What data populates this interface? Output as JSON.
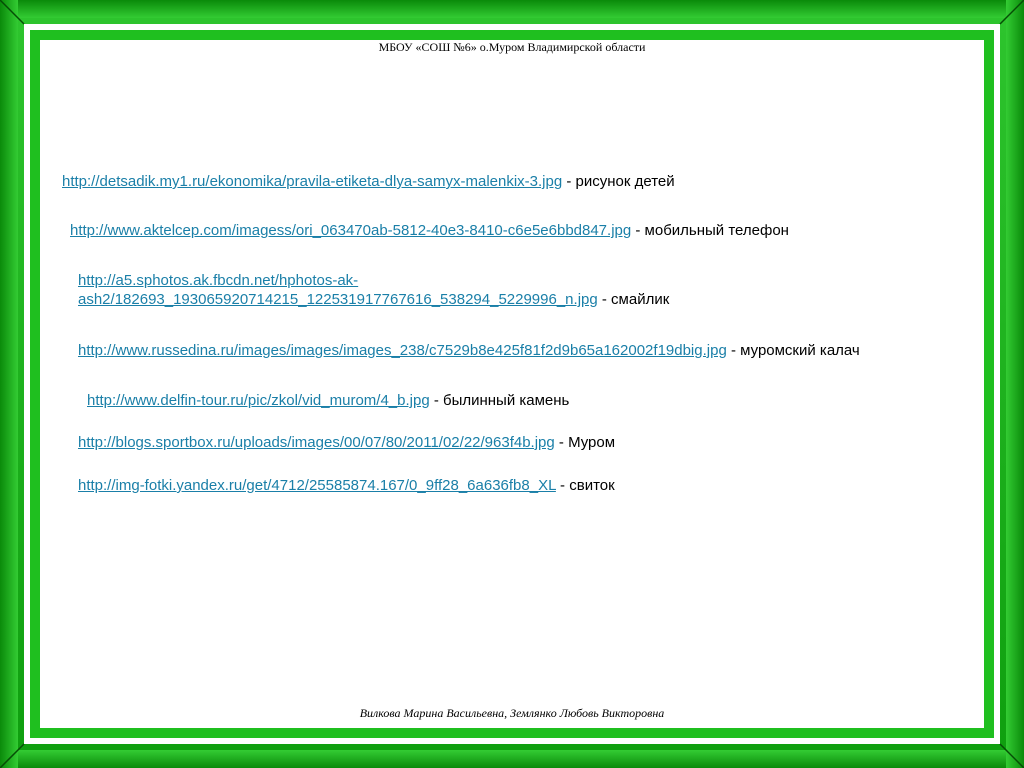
{
  "header": {
    "school": "МБОУ «СОШ №6» о.Муром Владимирской области"
  },
  "references": [
    {
      "url": "http://detsadik.my1.ru/ekonomika/pravila-etiketa-dlya-samyx-malenkix-3.jpg",
      "description": " - рисунок детей"
    },
    {
      "url": "http://www.aktelcep.com/imagess/ori_063470ab-5812-40e3-8410-c6e5e6bbd847.jpg",
      "description": " - мобильный телефон"
    },
    {
      "url_line1": "http://a5.sphotos.ak.fbcdn.net/hphotos-ak-",
      "url_line2": "ash2/182693_193065920714215_122531917767616_538294_5229996_n.jpg",
      "description": " - смайлик"
    },
    {
      "url": "http://www.russedina.ru/images/images/images_238/c7529b8e425f81f2d9b65a162002f19dbig.jpg",
      "description": " - муромский калач"
    },
    {
      "url": "http://www.delfin-tour.ru/pic/zkol/vid_murom/4_b.jpg",
      "description": " - былинный камень"
    },
    {
      "url": "http://blogs.sportbox.ru/uploads/images/00/07/80/2011/02/22/963f4b.jpg",
      "description": " - Муром"
    },
    {
      "url": "http://img-fotki.yandex.ru/get/4712/25585874.167/0_9ff28_6a636fb8_XL",
      "description": " - свиток"
    }
  ],
  "footer": {
    "authors": "Вилкова Марина Васильевна, Землянко Любовь Викторовна"
  },
  "colors": {
    "frame_green": "#1fbf1f",
    "link": "#1a7fa8"
  }
}
